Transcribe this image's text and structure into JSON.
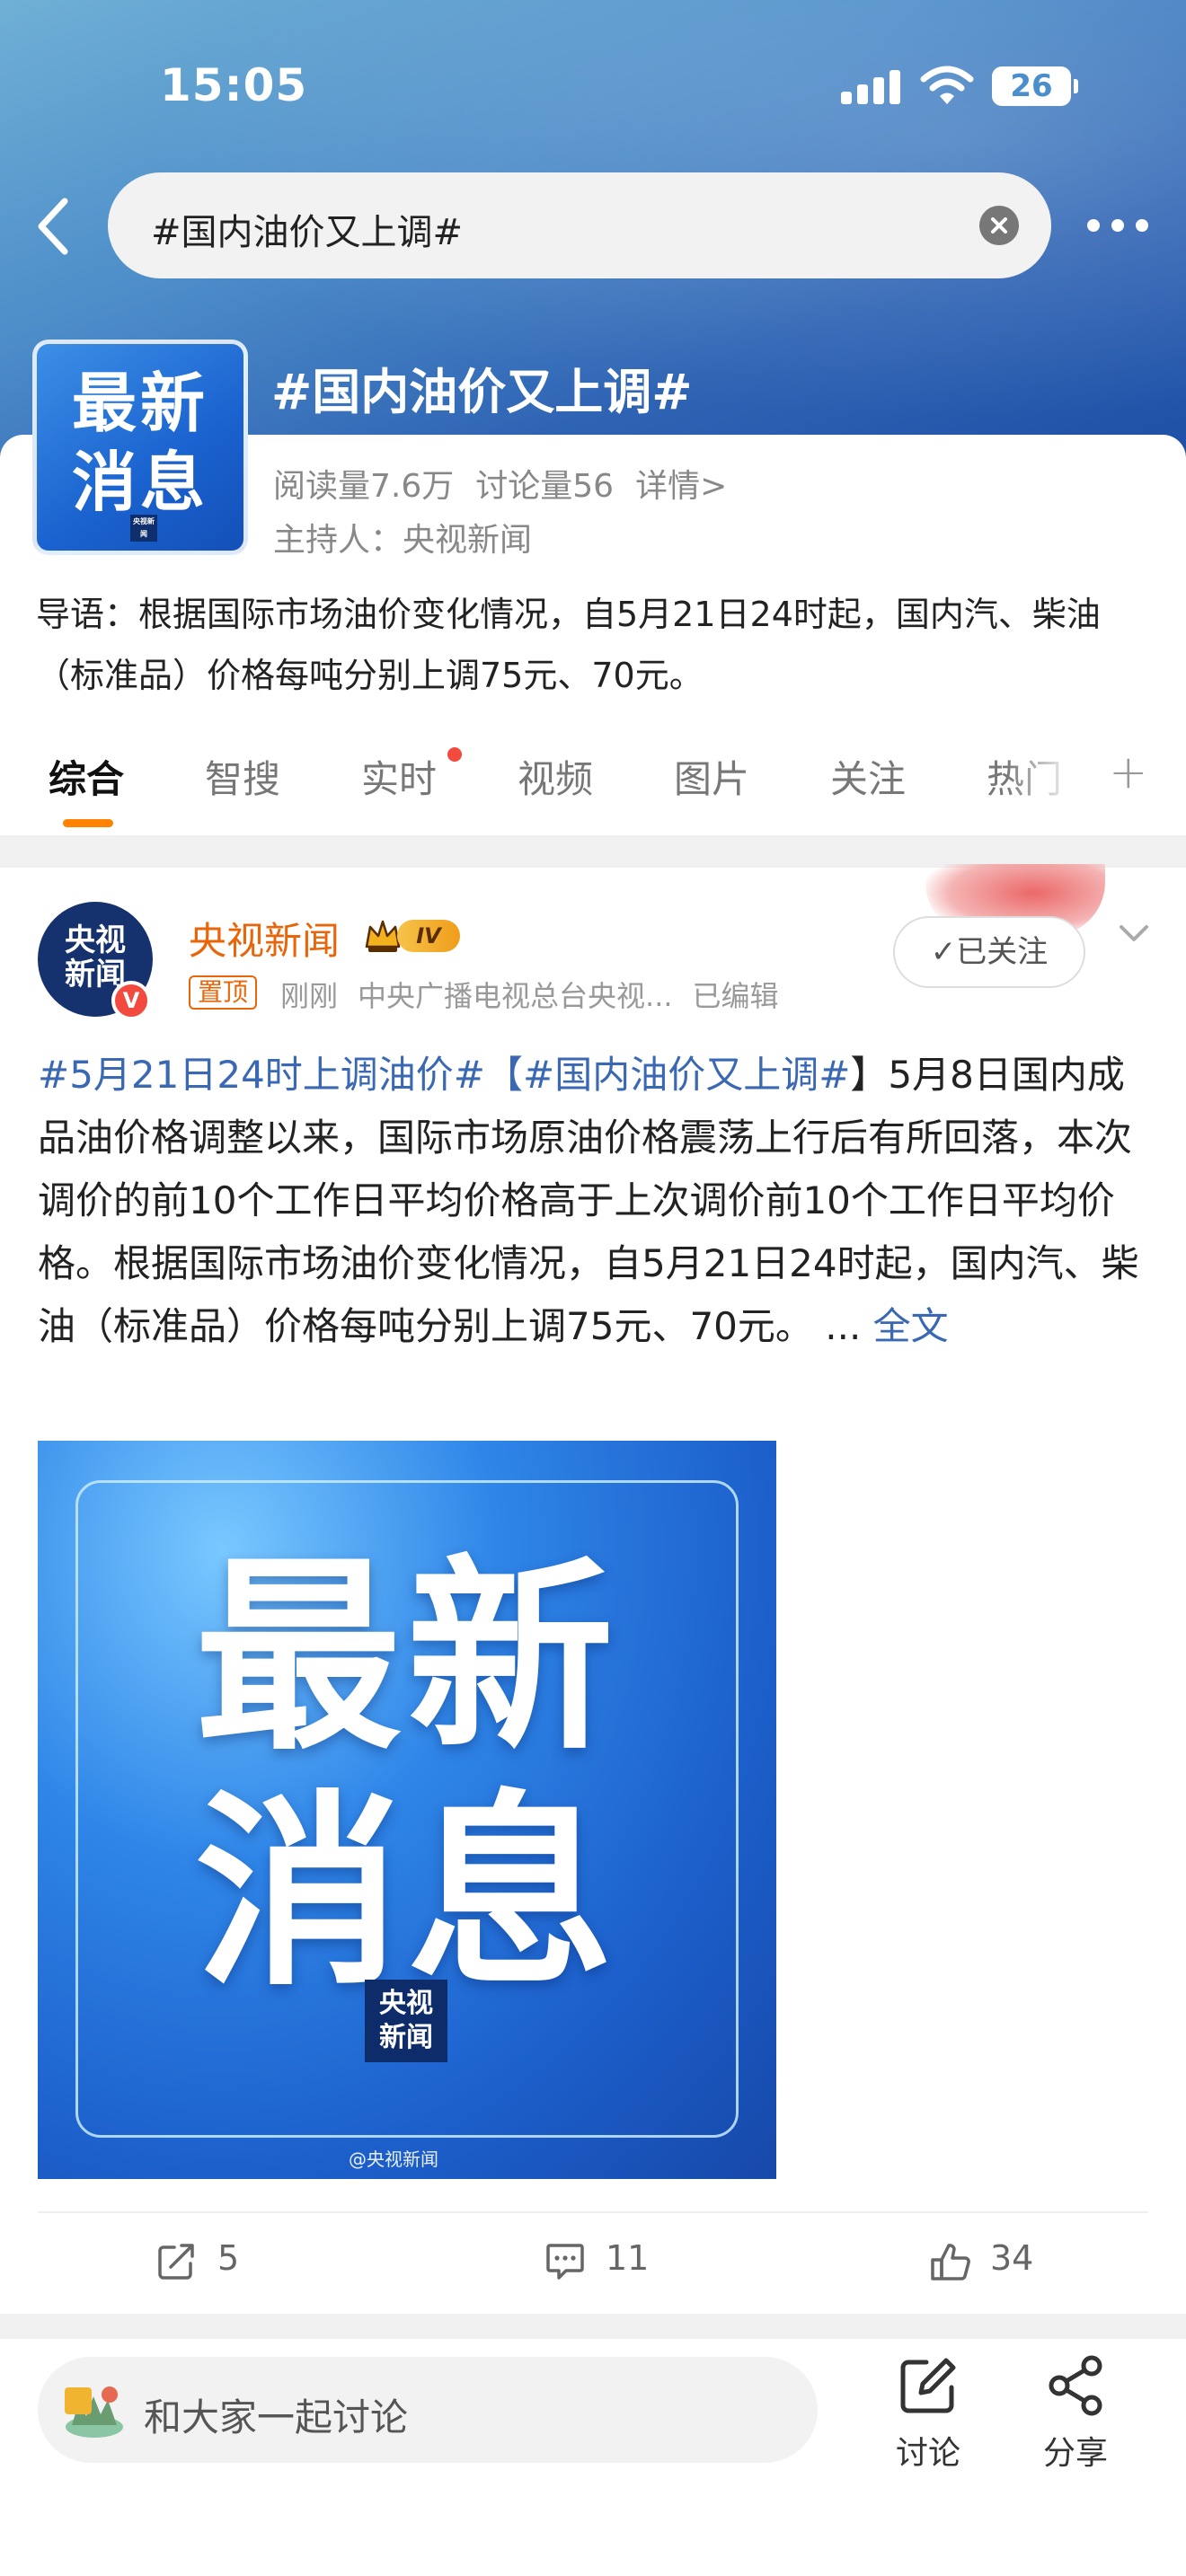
{
  "status_bar": {
    "time": "15:05",
    "battery": "26"
  },
  "search": {
    "query": "#国内油价又上调#"
  },
  "topic": {
    "logo_text_line1": "最新",
    "logo_text_line2": "消息",
    "logo_mini": "央视新闻",
    "title": "#国内油价又上调#",
    "reads": "阅读量7.6万",
    "discussions": "讨论量56",
    "details_link": "详情>",
    "host": "主持人：央视新闻",
    "intro": "导语：根据国际市场油价变化情况，自5月21日24时起，国内汽、柴油（标准品）价格每吨分别上调75元、70元。"
  },
  "tabs": [
    {
      "label": "综合",
      "active": true
    },
    {
      "label": "智搜"
    },
    {
      "label": "实时",
      "dot": true
    },
    {
      "label": "视频"
    },
    {
      "label": "图片"
    },
    {
      "label": "关注"
    },
    {
      "label": "热门"
    }
  ],
  "post": {
    "author": "央视新闻",
    "avatar_line1": "央视",
    "avatar_line2": "新闻",
    "level_badge": "IV",
    "verify_badge": "V",
    "pin_label": "置顶",
    "time": "刚刚",
    "source": "中央广播电视总台央视...",
    "edited": "已编辑",
    "follow_label": "✓已关注",
    "hashtag_1": "#5月21日24时上调油价#",
    "hashtag_2": "【#国内油价又上调#",
    "body": "】5月8日国内成品油价格调整以来，国际市场原油价格震荡上行后有所回落，本次调价的前10个工作日平均价格高于上次调价前10个工作日平均价格。根据国际市场油价变化情况，自5月21日24时起，国内汽、柴油（标准品）价格每吨分别上调75元、70元。 ... ",
    "full_text_link": "全文",
    "image": {
      "line1": "最新",
      "line2": "消息",
      "logo_line1": "央视",
      "logo_line2": "新闻",
      "watermark": "@央视新闻"
    },
    "reposts": "5",
    "comments": "11",
    "likes": "34"
  },
  "bottom_bar": {
    "placeholder": "和大家一起讨论",
    "discuss_label": "讨论",
    "share_label": "分享"
  },
  "colors": {
    "accent": "#ff8200",
    "link": "#3a68b3",
    "author": "#e8650a"
  }
}
